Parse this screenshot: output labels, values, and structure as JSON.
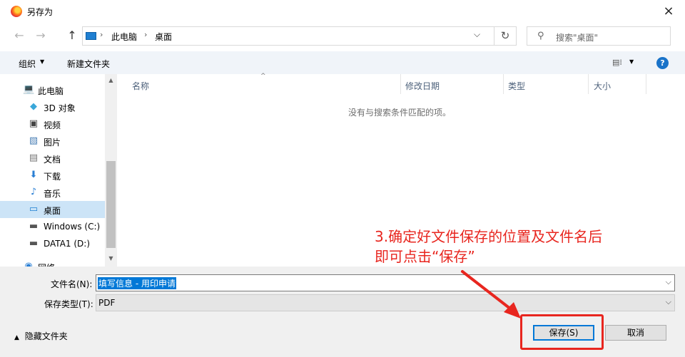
{
  "window": {
    "title": "另存为",
    "close_icon": "×",
    "app_icon": "firefox-icon"
  },
  "nav": {
    "back_icon": "←",
    "forward_icon": "→",
    "up_icon": "↑",
    "refresh_icon": "↻"
  },
  "address": {
    "sep": "›",
    "crumbs": [
      "此电脑",
      "桌面"
    ],
    "dropdown_icon": "⌵"
  },
  "search": {
    "icon": "⚲",
    "placeholder": "搜索\"桌面\""
  },
  "toolbar": {
    "organize_label": "组织",
    "caret": "▼",
    "new_folder_label": "新建文件夹",
    "view_icon": "▤⁞",
    "help_label": "?"
  },
  "sidebar": {
    "items": [
      {
        "label": "此电脑",
        "icon": "💻"
      },
      {
        "label": "3D 对象",
        "icon": "◆"
      },
      {
        "label": "视频",
        "icon": "▣"
      },
      {
        "label": "图片",
        "icon": "▧"
      },
      {
        "label": "文档",
        "icon": "▤"
      },
      {
        "label": "下载",
        "icon": "⬇"
      },
      {
        "label": "音乐",
        "icon": "♪"
      },
      {
        "label": "桌面",
        "icon": "▭"
      },
      {
        "label": "Windows (C:)",
        "icon": "▬"
      },
      {
        "label": "DATA1 (D:)",
        "icon": "▬"
      },
      {
        "label": "网络",
        "icon": "◉"
      }
    ],
    "selected": "桌面",
    "scroll_up": "▲",
    "scroll_down": "▼"
  },
  "list": {
    "columns": [
      "名称",
      "修改日期",
      "类型",
      "大小"
    ],
    "sort_icon": "^",
    "empty_message": "没有与搜索条件匹配的项。"
  },
  "form": {
    "filename_label": "文件名(N):",
    "filename_value": "填写信息 - 用印申请",
    "filetype_label": "保存类型(T):",
    "filetype_value": "PDF",
    "dropdown_icon": "⌵",
    "hide_folders_icon": "▲",
    "hide_folders_label": "隐藏文件夹",
    "save_label": "保存(S)",
    "cancel_label": "取消"
  },
  "annotation": {
    "line1": "3.确定好文件保存的位置及文件名后",
    "line2": "即可点击“保存”",
    "color": "#e8261f"
  }
}
